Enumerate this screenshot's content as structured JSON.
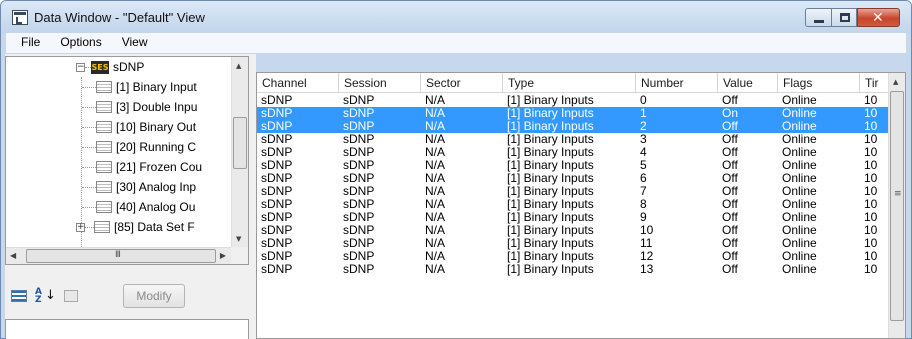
{
  "window": {
    "title": "Data Window - \"Default\" View",
    "caption": {
      "minimize": "",
      "maximize": "",
      "close": "✕"
    }
  },
  "menu": [
    "File",
    "Options",
    "View"
  ],
  "tree": {
    "root": {
      "icon": "ses-icon",
      "badge": "SES",
      "label": "sDNP",
      "expander": "−"
    },
    "items": [
      {
        "label": "[1] Binary Input"
      },
      {
        "label": "[3] Double Inpu"
      },
      {
        "label": "[10] Binary Out"
      },
      {
        "label": "[20] Running C"
      },
      {
        "label": "[21] Frozen Cou"
      },
      {
        "label": "[30] Analog Inp"
      },
      {
        "label": "[40] Analog Ou"
      },
      {
        "label": "[85] Data Set F",
        "expander": "+"
      }
    ],
    "scroll_glyphs": {
      "up": "▲",
      "down": "▼",
      "left": "◀",
      "right": "▶",
      "grip_h": "III",
      "grip_v": "≡"
    }
  },
  "toolbar": {
    "sort_az_label": "A\nZ",
    "sort_arrow": "↓",
    "modify_label": "Modify"
  },
  "grid": {
    "columns": [
      "Channel",
      "Session",
      "Sector",
      "Type",
      "Number",
      "Value",
      "Flags",
      "Tir"
    ],
    "rows": [
      {
        "channel": "sDNP",
        "session": "sDNP",
        "sector": "N/A",
        "type": "[1] Binary Inputs",
        "number": "0",
        "value": "Off",
        "flags": "Online",
        "time": "10",
        "selected": false
      },
      {
        "channel": "sDNP",
        "session": "sDNP",
        "sector": "N/A",
        "type": "[1] Binary Inputs",
        "number": "1",
        "value": "On",
        "flags": "Online",
        "time": "10",
        "selected": true
      },
      {
        "channel": "sDNP",
        "session": "sDNP",
        "sector": "N/A",
        "type": "[1] Binary Inputs",
        "number": "2",
        "value": "Off",
        "flags": "Online",
        "time": "10",
        "selected": true
      },
      {
        "channel": "sDNP",
        "session": "sDNP",
        "sector": "N/A",
        "type": "[1] Binary Inputs",
        "number": "3",
        "value": "Off",
        "flags": "Online",
        "time": "10",
        "selected": false
      },
      {
        "channel": "sDNP",
        "session": "sDNP",
        "sector": "N/A",
        "type": "[1] Binary Inputs",
        "number": "4",
        "value": "Off",
        "flags": "Online",
        "time": "10",
        "selected": false
      },
      {
        "channel": "sDNP",
        "session": "sDNP",
        "sector": "N/A",
        "type": "[1] Binary Inputs",
        "number": "5",
        "value": "Off",
        "flags": "Online",
        "time": "10",
        "selected": false
      },
      {
        "channel": "sDNP",
        "session": "sDNP",
        "sector": "N/A",
        "type": "[1] Binary Inputs",
        "number": "6",
        "value": "Off",
        "flags": "Online",
        "time": "10",
        "selected": false
      },
      {
        "channel": "sDNP",
        "session": "sDNP",
        "sector": "N/A",
        "type": "[1] Binary Inputs",
        "number": "7",
        "value": "Off",
        "flags": "Online",
        "time": "10",
        "selected": false
      },
      {
        "channel": "sDNP",
        "session": "sDNP",
        "sector": "N/A",
        "type": "[1] Binary Inputs",
        "number": "8",
        "value": "Off",
        "flags": "Online",
        "time": "10",
        "selected": false
      },
      {
        "channel": "sDNP",
        "session": "sDNP",
        "sector": "N/A",
        "type": "[1] Binary Inputs",
        "number": "9",
        "value": "Off",
        "flags": "Online",
        "time": "10",
        "selected": false
      },
      {
        "channel": "sDNP",
        "session": "sDNP",
        "sector": "N/A",
        "type": "[1] Binary Inputs",
        "number": "10",
        "value": "Off",
        "flags": "Online",
        "time": "10",
        "selected": false
      },
      {
        "channel": "sDNP",
        "session": "sDNP",
        "sector": "N/A",
        "type": "[1] Binary Inputs",
        "number": "11",
        "value": "Off",
        "flags": "Online",
        "time": "10",
        "selected": false
      },
      {
        "channel": "sDNP",
        "session": "sDNP",
        "sector": "N/A",
        "type": "[1] Binary Inputs",
        "number": "12",
        "value": "Off",
        "flags": "Online",
        "time": "10",
        "selected": false
      },
      {
        "channel": "sDNP",
        "session": "sDNP",
        "sector": "N/A",
        "type": "[1] Binary Inputs",
        "number": "13",
        "value": "Off",
        "flags": "Online",
        "time": "10",
        "selected": false
      }
    ],
    "selection_color": "#3399ff"
  }
}
